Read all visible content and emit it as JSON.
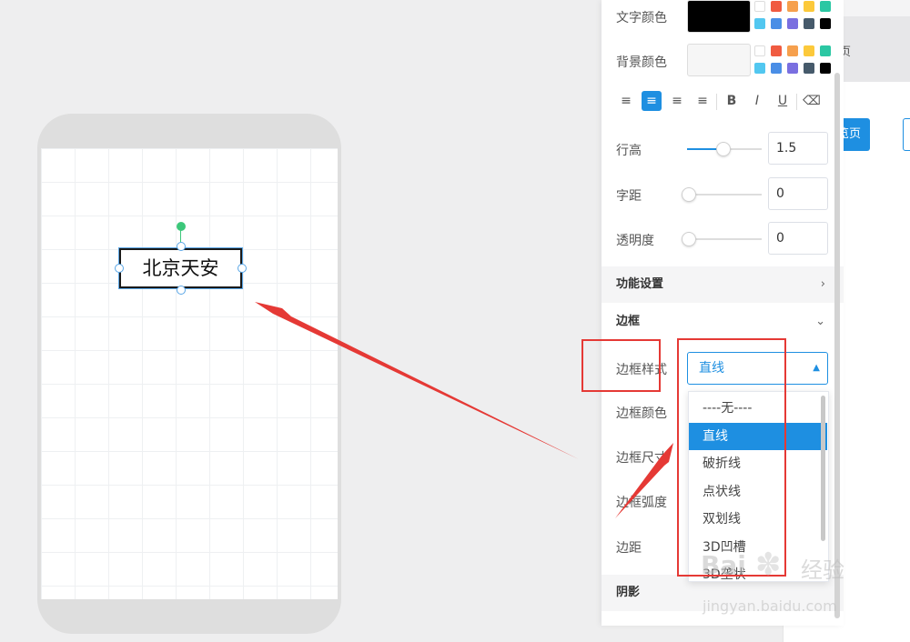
{
  "background_page": {
    "tab_text": "页",
    "preview_button": "览页"
  },
  "canvas": {
    "text_element": "北京天安"
  },
  "panel": {
    "text_color_label": "文字颜色",
    "bg_color_label": "背景颜色",
    "text_color_value": "#000000",
    "swatch_colors": [
      "#ffffff",
      "#f05b41",
      "#f6a04d",
      "#fcc93b",
      "#2bc7a3",
      "#52c7f0",
      "#4a8ee6",
      "#7a6fe0",
      "#465a6b",
      "#000000"
    ],
    "align_icons": [
      "align-left-icon",
      "align-center-icon",
      "align-right-icon",
      "align-justify-icon",
      "bold-icon",
      "italic-icon",
      "underline-icon",
      "eraser-icon"
    ],
    "align_glyphs": [
      "≡",
      "≡",
      "≡",
      "≡",
      "B",
      "I",
      "U",
      "⌫"
    ],
    "line_height": {
      "label": "行高",
      "value": "1.5",
      "slider_fraction": 0.5
    },
    "letter_spacing": {
      "label": "字距",
      "value": "0"
    },
    "opacity": {
      "label": "透明度",
      "value": "0"
    },
    "function_section": "功能设置",
    "border_section": "边框",
    "border_style": {
      "label": "边框样式",
      "value": "直线"
    },
    "border_color_label": "边框颜色",
    "border_size_label": "边框尺寸",
    "border_radius_label": "边框弧度",
    "padding_label": "边距",
    "shadow_section": "阴影",
    "dropdown_options": [
      "----无----",
      "直线",
      "破折线",
      "点状线",
      "双划线",
      "3D凹槽",
      "3D垄状"
    ],
    "selected_option": "直线"
  },
  "watermark": {
    "logo": "Bai",
    "text": "经验",
    "url": "jingyan.baidu.com"
  },
  "colors": {
    "accent": "#1e8fe1",
    "annotation_red": "#e53935",
    "handle_green": "#3cc77a"
  }
}
